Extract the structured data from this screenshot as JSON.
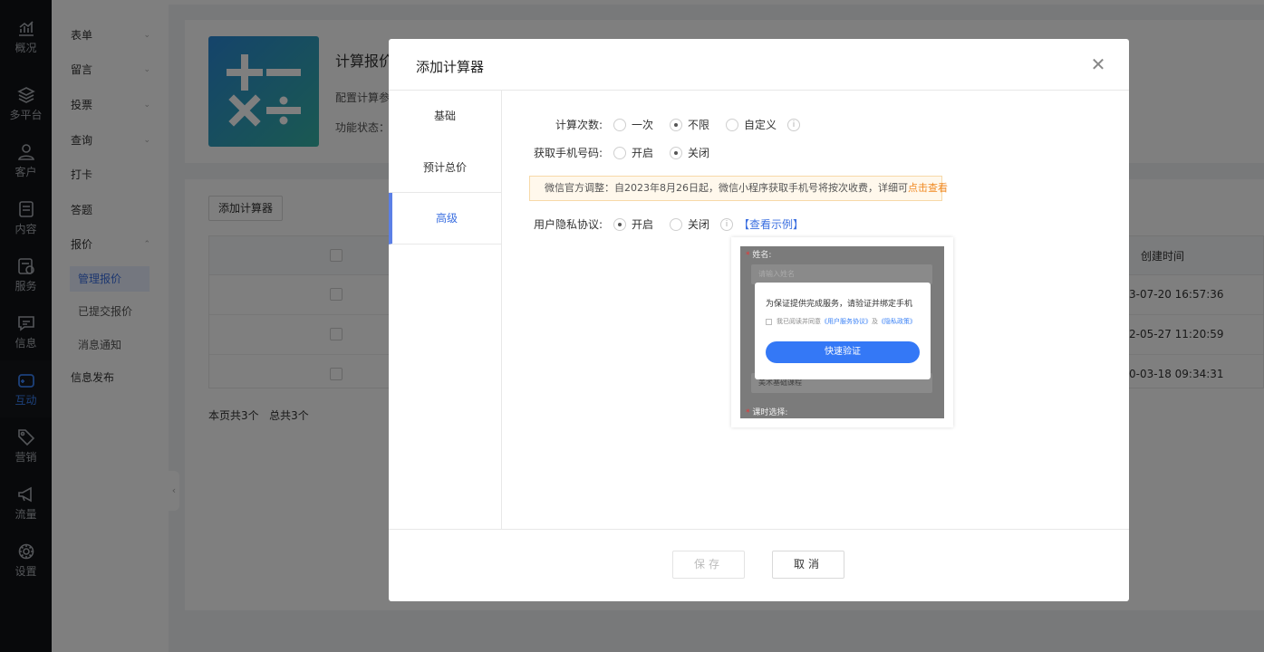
{
  "rail": {
    "items": [
      {
        "label": "概况",
        "icon": "chart-icon"
      },
      {
        "label": "多平台",
        "icon": "layers-icon"
      },
      {
        "label": "客户",
        "icon": "user-icon"
      },
      {
        "label": "内容",
        "icon": "document-icon"
      },
      {
        "label": "服务",
        "icon": "service-icon"
      },
      {
        "label": "信息",
        "icon": "message-icon"
      },
      {
        "label": "互动",
        "icon": "gamepad-icon"
      },
      {
        "label": "营销",
        "icon": "tag-icon"
      },
      {
        "label": "流量",
        "icon": "megaphone-icon"
      },
      {
        "label": "设置",
        "icon": "gear-icon"
      }
    ],
    "active_color": "#3b82f6"
  },
  "menu": {
    "items": [
      {
        "label": "表单"
      },
      {
        "label": "留言"
      },
      {
        "label": "投票"
      },
      {
        "label": "查询"
      },
      {
        "label": "打卡"
      },
      {
        "label": "答题"
      },
      {
        "label": "报价"
      },
      {
        "label": "信息发布"
      }
    ],
    "sub_items": [
      {
        "label": "管理报价"
      },
      {
        "label": "已提交报价"
      },
      {
        "label": "消息通知"
      }
    ]
  },
  "page": {
    "title": "计算报价",
    "desc": "配置计算参",
    "status_label": "功能状态：",
    "add_button": "添加计算器",
    "created_col": "创建时间",
    "rows": [
      {
        "date": "3-07-20 16:57:36"
      },
      {
        "date": "2-05-27 11:20:59"
      },
      {
        "date": "0-03-18 09:34:31"
      }
    ],
    "page_info": "本页共3个   总共3个"
  },
  "modal": {
    "title": "添加计算器",
    "tabs": [
      {
        "label": "基础"
      },
      {
        "label": "预计总价"
      },
      {
        "label": "高级"
      }
    ],
    "calc_times": {
      "label": "计算次数:",
      "options": [
        "一次",
        "不限",
        "自定义"
      ]
    },
    "get_phone": {
      "label": "获取手机号码:",
      "options": [
        "开启",
        "关闭"
      ]
    },
    "notice": {
      "text": "微信官方调整：自2023年8月26日起，微信小程序获取手机号将按次收费，详细可",
      "link": "点击查看"
    },
    "privacy": {
      "label": "用户隐私协议:",
      "options": [
        "开启",
        "关闭"
      ],
      "example_link": "【查看示例】"
    },
    "preview": {
      "name_label": "姓名:",
      "name_placeholder": "请输入姓名",
      "course_value": "美术基础课程",
      "time_label": "课时选择:",
      "dialog_title": "为保证提供完成服务，请验证并绑定手机",
      "agree_prefix": "我已阅读并同意",
      "agree_link1": "《用户服务协议》",
      "agree_mid": "及",
      "agree_link2": "《隐私政策》",
      "verify_button": "快速验证"
    },
    "save_button": "保存",
    "cancel_button": "取消"
  }
}
